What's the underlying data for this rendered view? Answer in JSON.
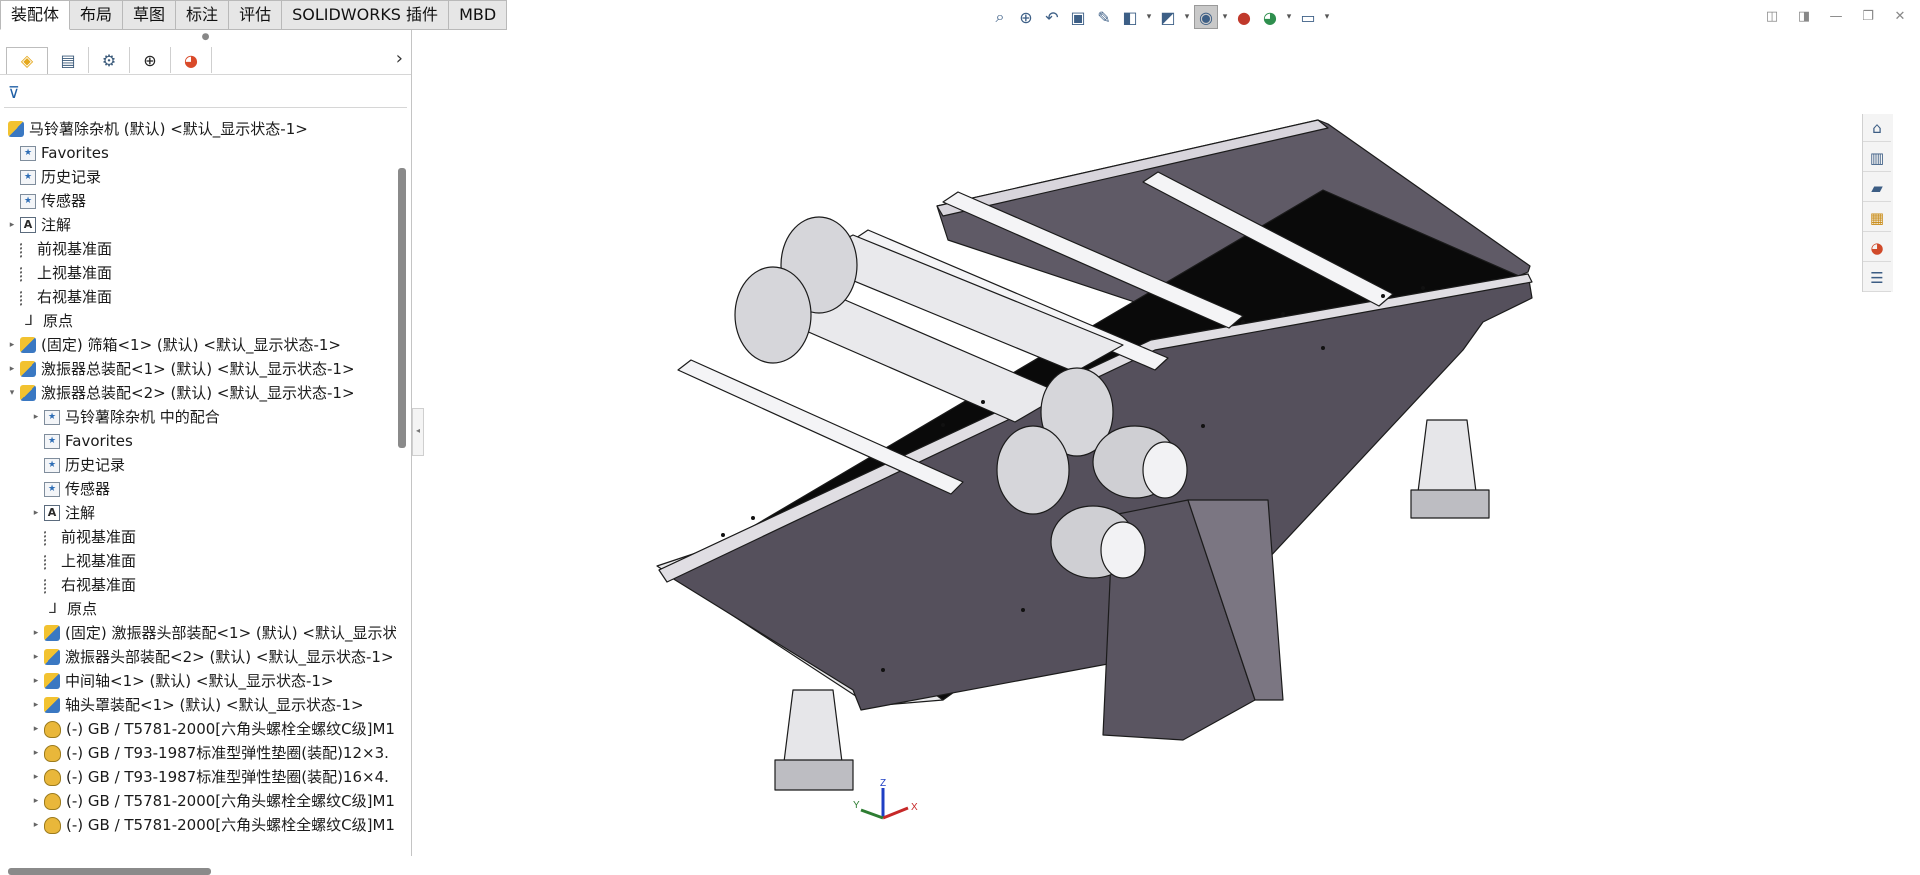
{
  "command_tabs": [
    {
      "label": "装配体",
      "active": true
    },
    {
      "label": "布局",
      "active": false
    },
    {
      "label": "草图",
      "active": false
    },
    {
      "label": "标注",
      "active": false
    },
    {
      "label": "评估",
      "active": false
    },
    {
      "label": "SOLIDWORKS 插件",
      "active": false
    },
    {
      "label": "MBD",
      "active": false
    }
  ],
  "heads_up_toolbar": {
    "icons": [
      "zoom-to-fit-icon",
      "zoom-to-area-icon",
      "previous-view-icon",
      "section-view-icon",
      "dynamic-annotation-icon",
      "view-orientation-icon",
      "display-style-icon",
      "hide-show-items-icon",
      "edit-appearance-icon",
      "apply-scene-icon",
      "view-settings-icon"
    ]
  },
  "window_controls": [
    "tile-left-icon",
    "tile-right-icon",
    "minimize-icon",
    "restore-icon",
    "close-icon"
  ],
  "panel": {
    "tabs": [
      "featuremanager-icon",
      "propertymanager-icon",
      "configurationmanager-icon",
      "dimxpert-icon",
      "displaymanager-icon"
    ],
    "expand_glyph": "›",
    "filter_glyph": "⊽"
  },
  "tree": {
    "root": "马铃薯除杂机 (默认) <默认_显示状态-1>",
    "items": [
      {
        "label": "Favorites",
        "indent": 1,
        "icon": "folder"
      },
      {
        "label": "历史记录",
        "indent": 1,
        "icon": "folder"
      },
      {
        "label": "传感器",
        "indent": 1,
        "icon": "folder"
      },
      {
        "label": "注解",
        "indent": 1,
        "icon": "note",
        "arrow": true
      },
      {
        "label": "前视基准面",
        "indent": 1,
        "icon": "plane"
      },
      {
        "label": "上视基准面",
        "indent": 1,
        "icon": "plane"
      },
      {
        "label": "右视基准面",
        "indent": 1,
        "icon": "plane"
      },
      {
        "label": "原点",
        "indent": 1,
        "icon": "origin"
      },
      {
        "label": "(固定) 筛箱<1> (默认) <默认_显示状态-1>",
        "indent": 1,
        "icon": "asm",
        "arrow": true
      },
      {
        "label": "激振器总装配<1> (默认) <默认_显示状态-1>",
        "indent": 1,
        "icon": "asm",
        "arrow": true
      },
      {
        "label": "激振器总装配<2> (默认) <默认_显示状态-1>",
        "indent": 1,
        "icon": "asm",
        "arrow": true,
        "expanded": true
      },
      {
        "label": "马铃薯除杂机 中的配合",
        "indent": 2,
        "icon": "folder",
        "arrow": true
      },
      {
        "label": "Favorites",
        "indent": 2,
        "icon": "folder"
      },
      {
        "label": "历史记录",
        "indent": 2,
        "icon": "folder"
      },
      {
        "label": "传感器",
        "indent": 2,
        "icon": "folder"
      },
      {
        "label": "注解",
        "indent": 2,
        "icon": "note",
        "arrow": true
      },
      {
        "label": "前视基准面",
        "indent": 2,
        "icon": "plane"
      },
      {
        "label": "上视基准面",
        "indent": 2,
        "icon": "plane"
      },
      {
        "label": "右视基准面",
        "indent": 2,
        "icon": "plane"
      },
      {
        "label": "原点",
        "indent": 2,
        "icon": "origin"
      },
      {
        "label": "(固定) 激振器头部装配<1> (默认) <默认_显示状",
        "indent": 2,
        "icon": "asm",
        "arrow": true
      },
      {
        "label": "激振器头部装配<2> (默认) <默认_显示状态-1>",
        "indent": 2,
        "icon": "asm",
        "arrow": true
      },
      {
        "label": "中间轴<1> (默认) <默认_显示状态-1>",
        "indent": 2,
        "icon": "asm",
        "arrow": true
      },
      {
        "label": "轴头罩装配<1> (默认) <默认_显示状态-1>",
        "indent": 2,
        "icon": "asm",
        "arrow": true
      },
      {
        "label": "(-) GB / T5781-2000[六角头螺栓全螺纹C级]M1",
        "indent": 2,
        "icon": "part",
        "arrow": true
      },
      {
        "label": "(-) GB / T93-1987标准型弹性垫圈(装配)12×3.",
        "indent": 2,
        "icon": "part",
        "arrow": true
      },
      {
        "label": "(-) GB / T93-1987标准型弹性垫圈(装配)16×4.",
        "indent": 2,
        "icon": "part",
        "arrow": true
      },
      {
        "label": "(-) GB / T5781-2000[六角头螺栓全螺纹C级]M1",
        "indent": 2,
        "icon": "part",
        "arrow": true
      },
      {
        "label": "(-) GB / T5781-2000[六角头螺栓全螺纹C级]M1",
        "indent": 2,
        "icon": "part",
        "arrow": true
      }
    ]
  },
  "task_pane": [
    "home-icon",
    "design-library-icon",
    "file-explorer-icon",
    "view-palette-icon",
    "appearances-icon",
    "custom-properties-icon"
  ],
  "triad": {
    "x": "X",
    "y": "Y",
    "z": "Z"
  }
}
